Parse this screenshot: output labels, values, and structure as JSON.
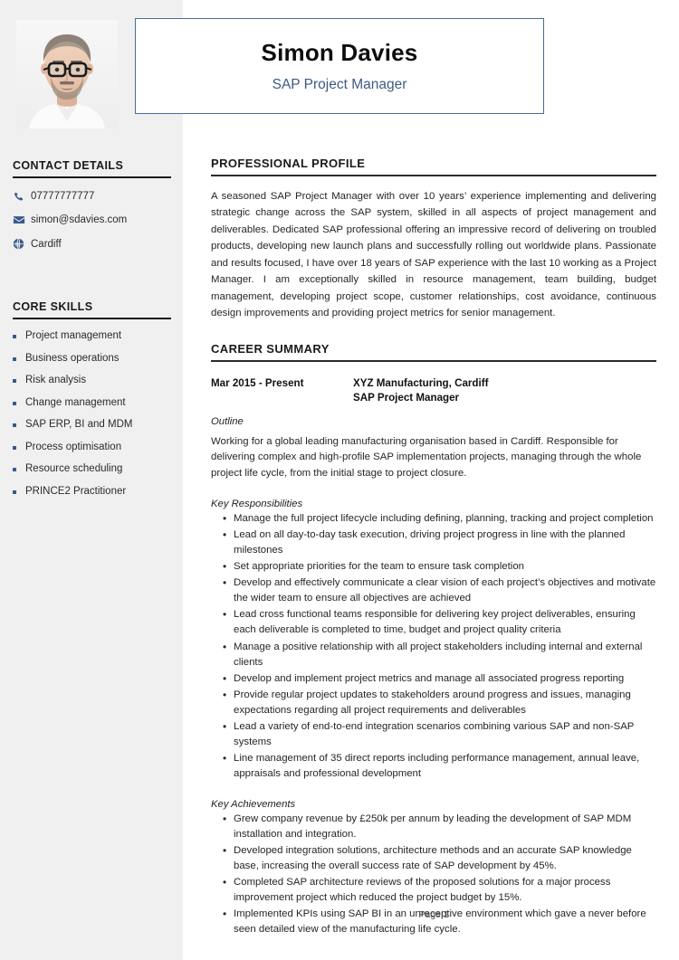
{
  "header": {
    "name": "Simon Davies",
    "role": "SAP Project Manager",
    "photo_alt": "headshot-photo",
    "border_color": "#4a6d99",
    "role_color": "#3d5a80"
  },
  "sidebar": {
    "background_color": "#f0f0f0",
    "accent_color": "#3a5a8c",
    "contact": {
      "heading": "CONTACT DETAILS",
      "items": [
        {
          "icon": "phone-icon",
          "value": "07777777777"
        },
        {
          "icon": "envelope-icon",
          "value": "simon@sdavies.com"
        },
        {
          "icon": "globe-icon",
          "value": "Cardiff"
        }
      ]
    },
    "skills": {
      "heading": "CORE SKILLS",
      "items": [
        "Project management",
        "Business operations",
        "Risk analysis",
        "Change management",
        "SAP ERP, BI and MDM",
        "Process optimisation",
        "Resource scheduling",
        "PRINCE2 Practitioner"
      ]
    }
  },
  "main": {
    "profile": {
      "heading": "PROFESSIONAL PROFILE",
      "text": "A seasoned SAP Project Manager with over 10 years’ experience implementing and delivering strategic change across the SAP system, skilled in all aspects of project management and deliverables. Dedicated SAP professional offering an impressive record of delivering on troubled products, developing new launch plans and successfully rolling out worldwide plans. Passionate and results focused, I have over 18 years of SAP experience with the last 10 working as a Project Manager. I am exceptionally skilled in resource management, team building, budget management, developing project scope, customer relationships, cost avoidance, continuous design improvements and providing project metrics for senior management."
    },
    "career": {
      "heading": "CAREER SUMMARY",
      "jobs": [
        {
          "dates": "Mar 2015 - Present",
          "company": "XYZ Manufacturing, Cardiff",
          "title": "SAP Project Manager",
          "outline_label": "Outline",
          "outline_text": "Working for a global leading manufacturing organisation based in Cardiff. Responsible for delivering complex and high-profile SAP implementation projects, managing through the whole project life cycle, from the initial stage to project closure.",
          "responsibilities_label": "Key Responsibilities",
          "responsibilities": [
            "Manage the full project lifecycle including defining, planning, tracking and project completion",
            "Lead on all day-to-day task execution, driving project progress in line with the planned milestones",
            "Set appropriate priorities for the team to ensure task completion",
            "Develop and effectively communicate a clear vision of each project’s objectives and motivate the wider team to ensure all objectives are achieved",
            "Lead cross functional teams responsible for delivering key project deliverables, ensuring each deliverable is completed to time, budget and project quality criteria",
            "Manage a positive relationship with all project stakeholders including internal and external clients",
            "Develop and implement project metrics and manage all associated progress reporting",
            "Provide regular project updates to stakeholders around progress and issues, managing expectations regarding all project requirements and deliverables",
            "Lead a variety of end-to-end integration scenarios combining various SAP and non-SAP systems",
            "Line management of 35 direct reports including performance management, annual leave, appraisals and professional development"
          ],
          "achievements_label": "Key Achievements",
          "achievements": [
            "Grew company revenue by £250k per annum by leading the development of SAP MDM installation and integration.",
            "Developed integration solutions, architecture methods and an accurate SAP knowledge base, increasing the overall success rate of SAP development by 45%.",
            "Completed SAP architecture reviews of the proposed solutions for a major process improvement project which reduced the project budget by 15%.",
            "Implemented KPIs using SAP BI in an unreceptive environment which gave a never before seen detailed view of the manufacturing life cycle."
          ]
        }
      ]
    }
  },
  "footer": {
    "page_label": "Page 1"
  }
}
